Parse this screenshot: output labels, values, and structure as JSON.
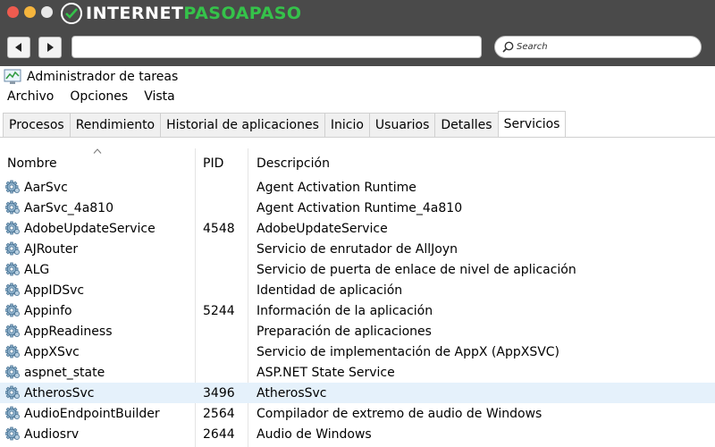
{
  "browser": {
    "logo_part1": "INTERNET",
    "logo_part2": "PASOAPASO",
    "search_placeholder": "Search",
    "colors": {
      "chrome": "#4a4a4a",
      "close": "#ee5b4f",
      "minimize": "#f5b53d",
      "maximize": "#e8e8e8",
      "logo_green": "#35c24a"
    }
  },
  "app": {
    "title": "Administrador de tareas",
    "menu": [
      "Archivo",
      "Opciones",
      "Vista"
    ],
    "tabs": [
      "Procesos",
      "Rendimiento",
      "Historial de aplicaciones",
      "Inicio",
      "Usuarios",
      "Detalles",
      "Servicios"
    ],
    "active_tab": "Servicios"
  },
  "table": {
    "headers": {
      "name": "Nombre",
      "pid": "PID",
      "description": "Descripción"
    },
    "rows": [
      {
        "name": "AarSvc",
        "pid": "",
        "description": "Agent Activation Runtime"
      },
      {
        "name": "AarSvc_4a810",
        "pid": "",
        "description": "Agent Activation Runtime_4a810"
      },
      {
        "name": "AdobeUpdateService",
        "pid": "4548",
        "description": "AdobeUpdateService"
      },
      {
        "name": "AJRouter",
        "pid": "",
        "description": "Servicio de enrutador de AllJoyn"
      },
      {
        "name": "ALG",
        "pid": "",
        "description": "Servicio de puerta de enlace de nivel de aplicación"
      },
      {
        "name": "AppIDSvc",
        "pid": "",
        "description": "Identidad de aplicación"
      },
      {
        "name": "Appinfo",
        "pid": "5244",
        "description": "Información de la aplicación"
      },
      {
        "name": "AppReadiness",
        "pid": "",
        "description": "Preparación de aplicaciones"
      },
      {
        "name": "AppXSvc",
        "pid": "",
        "description": "Servicio de implementación de AppX (AppXSVC)"
      },
      {
        "name": "aspnet_state",
        "pid": "",
        "description": "ASP.NET State Service"
      },
      {
        "name": "AtherosSvc",
        "pid": "3496",
        "description": "AtherosSvc",
        "selected": true
      },
      {
        "name": "AudioEndpointBuilder",
        "pid": "2564",
        "description": "Compilador de extremo de audio de Windows"
      },
      {
        "name": "Audiosrv",
        "pid": "2644",
        "description": "Audio de Windows"
      }
    ]
  }
}
